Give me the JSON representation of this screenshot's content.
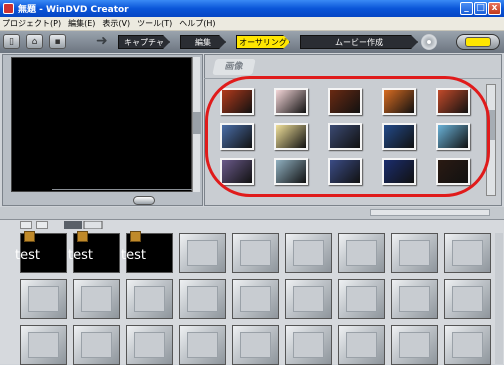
{
  "window": {
    "title": "WinDVD Creator",
    "title_prefix": "無題 -"
  },
  "menu": [
    "プロジェクト(P)",
    "編集(E)",
    "表示(V)",
    "ツール(T)",
    "ヘルプ(H)"
  ],
  "steps": {
    "capture": "キャプチャ",
    "edit": "編集",
    "authoring": "オーサリング",
    "movie": "ムービー作成"
  },
  "library": {
    "album_label": "画像"
  },
  "thumbnails": [
    [
      "#b23a1c",
      "#f4d6d8",
      "#6a2a12",
      "#d86c22",
      "#c24a2a"
    ],
    [
      "#4a6ea8",
      "#f0e09a",
      "#3b4a73",
      "#234a8a",
      "#6ab2d8"
    ],
    [
      "#6a5a8a",
      "#90b0c0",
      "#3b4c86",
      "#1b2d6e",
      "#2a1a12"
    ]
  ],
  "storyboard": {
    "clip_text": "test",
    "filled_slots": 3,
    "columns": 9,
    "rows": 3
  },
  "colors": {
    "accent": "#ffe600",
    "highlight": "#e01b1b",
    "titlebar": "#0a55d8"
  }
}
